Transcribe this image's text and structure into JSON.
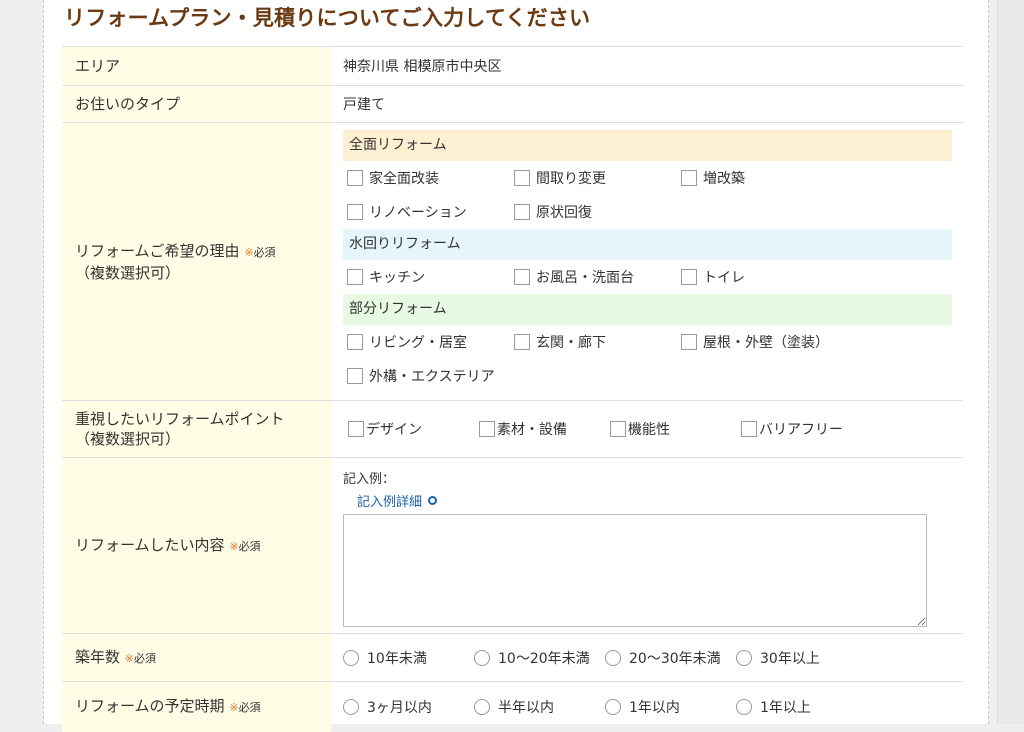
{
  "title": "リフォームプラン・見積りについてご入力してください",
  "required_mark": "※",
  "required_text": "必須",
  "area": {
    "label": "エリア",
    "value": "神奈川県 相模原市中央区"
  },
  "house_type": {
    "label": "お住いのタイプ",
    "value": "戸建て"
  },
  "reason": {
    "label": "リフォームご希望の理由",
    "sublabel": "（複数選択可）",
    "categories": [
      {
        "name": "全面リフォーム",
        "options": [
          "家全面改装",
          "間取り変更",
          "増改築",
          "リノベーション",
          "原状回復"
        ]
      },
      {
        "name": "水回りリフォーム",
        "options": [
          "キッチン",
          "お風呂・洗面台",
          "トイレ"
        ]
      },
      {
        "name": "部分リフォーム",
        "options": [
          "リビング・居室",
          "玄関・廊下",
          "屋根・外壁（塗装）",
          "外構・エクステリア"
        ]
      }
    ]
  },
  "points": {
    "label": "重視したいリフォームポイント",
    "sublabel": "（複数選択可）",
    "options": [
      "デザイン",
      "素材・設備",
      "機能性",
      "バリアフリー"
    ]
  },
  "content": {
    "label": "リフォームしたい内容",
    "example_label": "記入例：",
    "example_link": "記入例詳細",
    "textarea_value": ""
  },
  "building_age": {
    "label": "築年数",
    "options": [
      "10年未満",
      "10～20年未満",
      "20～30年未満",
      "30年以上"
    ]
  },
  "schedule": {
    "label": "リフォームの予定時期",
    "options": [
      "3ヶ月以内",
      "半年以内",
      "1年以内",
      "1年以上"
    ]
  },
  "colors": {
    "label_bg": "#fffde6",
    "title": "#6b3a12",
    "required": "#e27a2f",
    "cat_full": "#fcefd2",
    "cat_water": "#e6f5fc",
    "cat_part": "#e7f8e3",
    "link": "#1a5fa8"
  }
}
